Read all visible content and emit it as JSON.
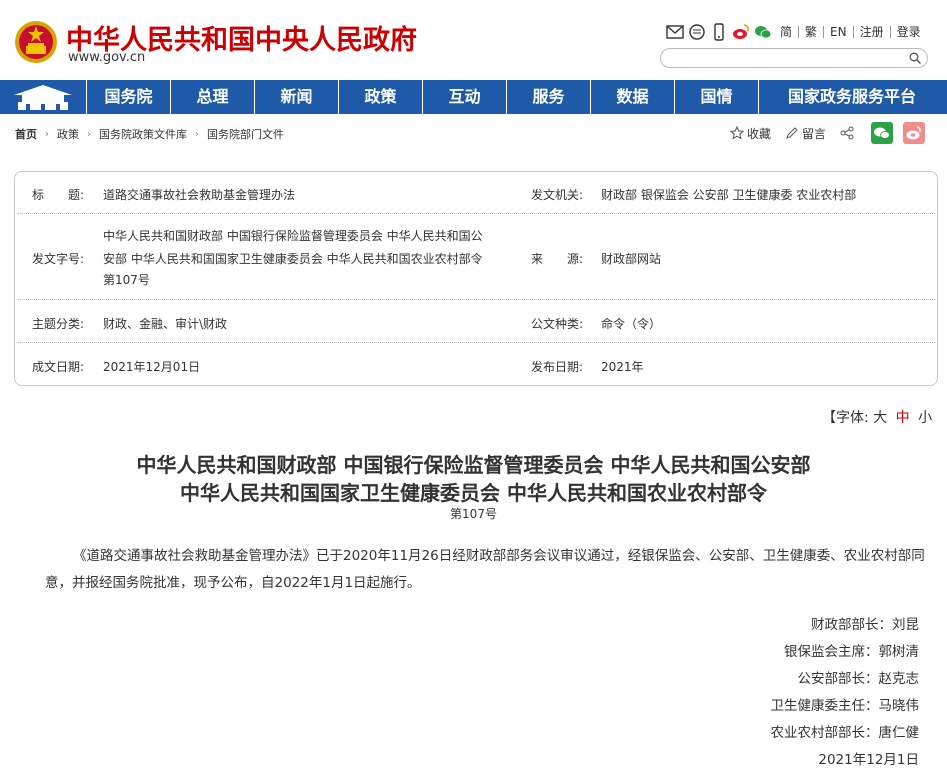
{
  "header": {
    "site_title": "中华人民共和国中央人民政府",
    "site_url": "www.gov.cn",
    "links": [
      "简",
      "繁",
      "EN",
      "注册",
      "登录"
    ],
    "icons": [
      "mail-icon",
      "message-icon",
      "mobile-icon",
      "weibo-icon",
      "wechat-icon"
    ]
  },
  "nav": {
    "items": [
      "国务院",
      "总理",
      "新闻",
      "政策",
      "互动",
      "服务",
      "数据",
      "国情",
      "国家政务服务平台"
    ]
  },
  "breadcrumb": [
    "首页",
    "政策",
    "国务院政策文件库",
    "国务院部门文件"
  ],
  "tools": {
    "collect": "收藏",
    "comment": "留言"
  },
  "info": {
    "title_label": "标　　题:",
    "title_value": "道路交通事故社会救助基金管理办法",
    "issuer_label": "发文机关:",
    "issuer_value": "财政部 银保监会 公安部 卫生健康委 农业农村部",
    "docnum_label": "发文字号:",
    "docnum_lines": [
      "中华人民共和国财政部 中国银行保险监督管理委员会 中华人民共和国公",
      "安部 中华人民共和国国家卫生健康委员会 中华人民共和国农业农村部令",
      "第107号"
    ],
    "source_label": "来　　源:",
    "source_value": "财政部网站",
    "topic_label": "主题分类:",
    "topic_value": "财政、金融、审计\\财政",
    "type_label": "公文种类:",
    "type_value": "命令（令）",
    "written_label": "成文日期:",
    "written_value": "2021年12月01日",
    "published_label": "发布日期:",
    "published_value": "2021年"
  },
  "font_size": {
    "prefix": "【字体:",
    "large": "大",
    "medium": "中",
    "small": "小"
  },
  "article": {
    "title_line1": "中华人民共和国财政部  中国银行保险监督管理委员会  中华人民共和国公安部",
    "title_line2": "中华人民共和国国家卫生健康委员会  中华人民共和国农业农村部令",
    "doc_no": "第107号",
    "paragraph": "《道路交通事故社会救助基金管理办法》已于2020年11月26日经财政部部务会议审议通过，经银保监会、公安部、卫生健康委、农业农村部同意，并报经国务院批准，现予公布，自2022年1月1日起施行。",
    "signatures": [
      "财政部部长：刘昆",
      "银保监会主席：郭树清",
      "公安部部长：赵克志",
      "卫生健康委主任：马晓伟",
      "农业农村部部长：唐仁健",
      "2021年12月1日"
    ]
  },
  "colors": {
    "brand_red": "#cc0000",
    "nav_blue": "#1e5aa8"
  }
}
